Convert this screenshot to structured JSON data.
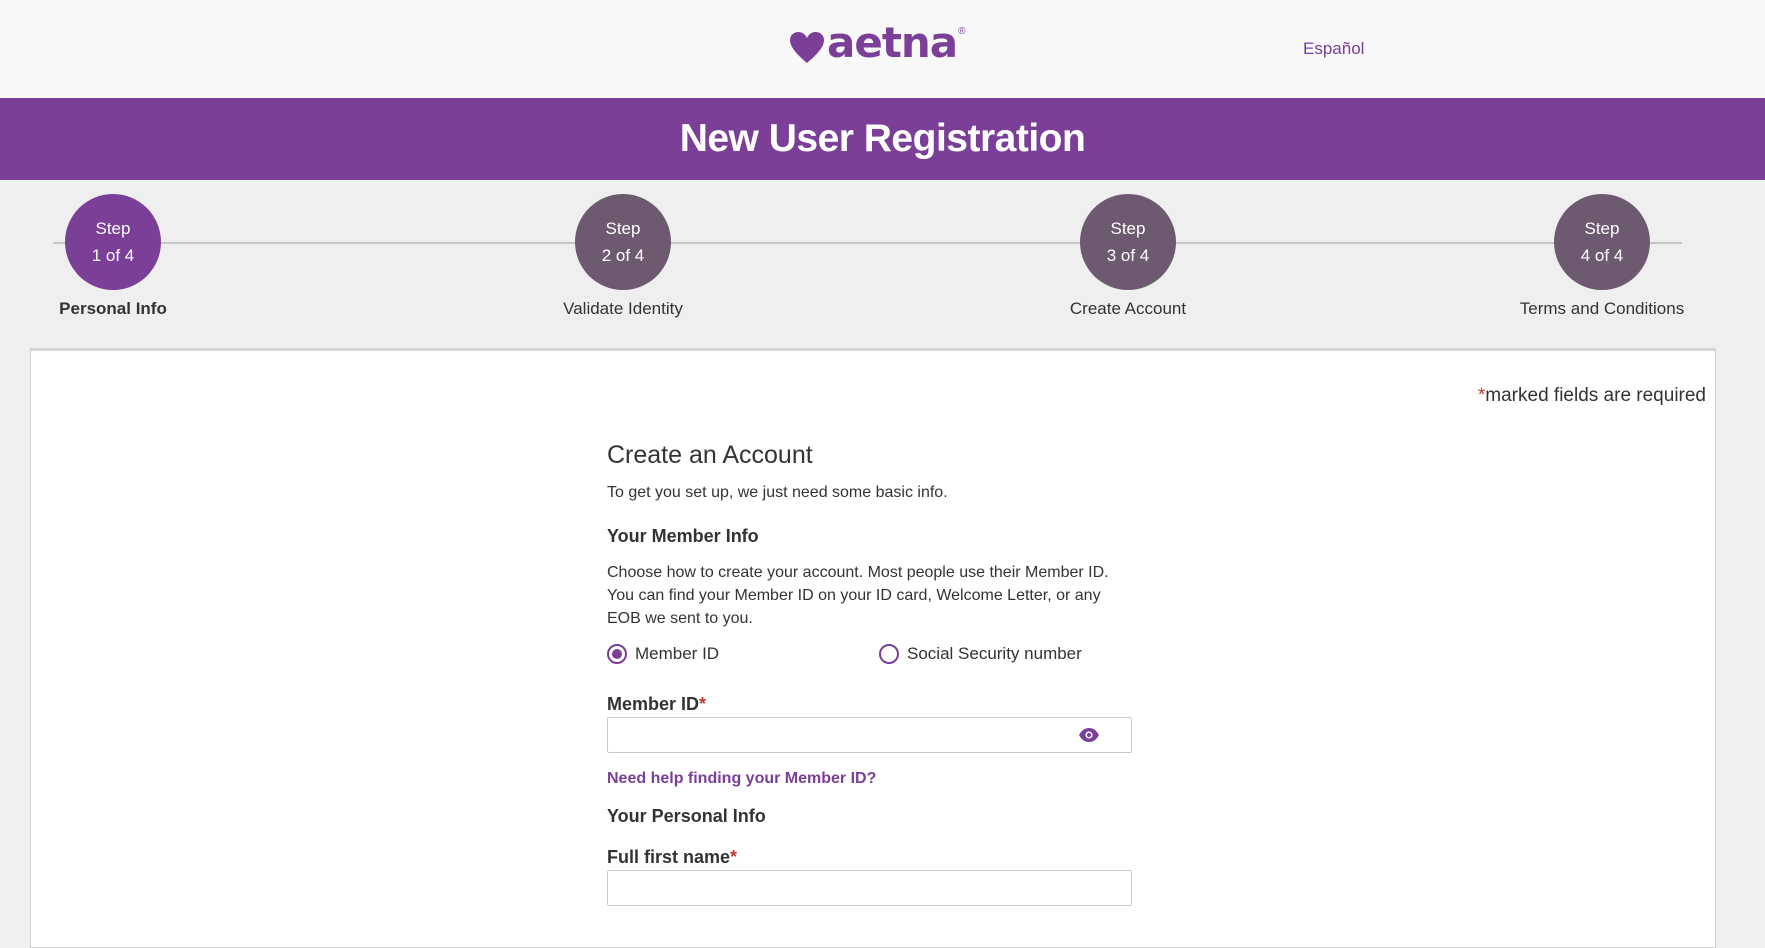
{
  "header": {
    "logo_text": "aetna",
    "logo_reg": "®",
    "language_link": "Español"
  },
  "banner": {
    "title": "New User Registration"
  },
  "stepper": {
    "steps": [
      {
        "line1": "Step",
        "line2": "1 of 4",
        "label": "Personal Info",
        "active": true
      },
      {
        "line1": "Step",
        "line2": "2 of 4",
        "label": "Validate Identity",
        "active": false
      },
      {
        "line1": "Step",
        "line2": "3 of 4",
        "label": "Create Account",
        "active": false
      },
      {
        "line1": "Step",
        "line2": "4 of 4",
        "label": "Terms and Conditions",
        "active": false
      }
    ]
  },
  "form": {
    "required_star": "*",
    "required_note": "marked fields are required",
    "title": "Create an Account",
    "intro": "To get you set up, we just need some basic info.",
    "member_section_title": "Your Member Info",
    "member_description": "Choose how to create your account. Most people use their Member ID. You can find your Member ID on your ID card, Welcome Letter, or any EOB we sent to you.",
    "radio_options": [
      {
        "label": "Member ID",
        "selected": true
      },
      {
        "label": "Social Security number",
        "selected": false
      }
    ],
    "member_id_label": "Member ID",
    "member_id_value": "",
    "help_link": "Need help finding your Member ID?",
    "personal_section_title": "Your Personal Info",
    "first_name_label": "Full first name",
    "first_name_value": ""
  },
  "colors": {
    "brand_purple": "#7b3f98",
    "step_inactive": "#6e5a70",
    "required_red": "#c0392b"
  },
  "icons": {
    "logo": "heart-icon",
    "reveal": "eye-icon"
  }
}
